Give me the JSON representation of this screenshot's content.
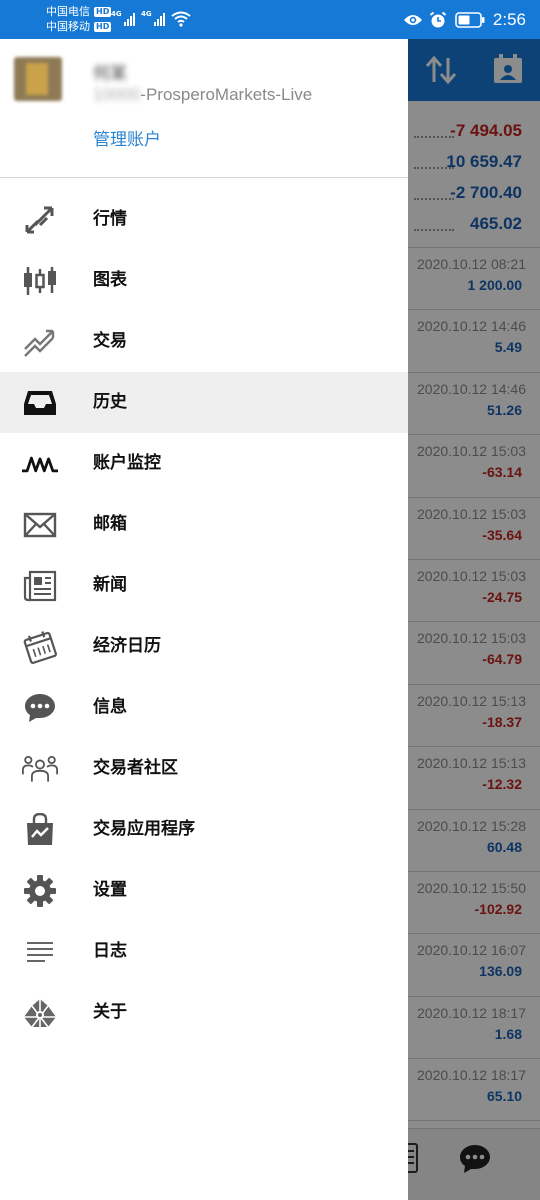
{
  "status_bar": {
    "carrier_1": "中国电信",
    "carrier_2": "中国移动",
    "hd": "HD",
    "network": "4G",
    "time": "2:56"
  },
  "account": {
    "name": "何某",
    "server_prefix": "10000",
    "server_suffix": "-ProsperoMarkets-Live",
    "manage_label": "管理账户"
  },
  "menu": [
    {
      "label": "行情",
      "icon": "quotes-arrows-icon"
    },
    {
      "label": "图表",
      "icon": "candlestick-chart-icon"
    },
    {
      "label": "交易",
      "icon": "trade-trend-icon"
    },
    {
      "label": "历史",
      "icon": "history-inbox-icon",
      "active": true
    },
    {
      "label": "账户监控",
      "icon": "account-monitor-icon"
    },
    {
      "label": "邮箱",
      "icon": "mail-envelope-icon"
    },
    {
      "label": "新闻",
      "icon": "news-icon"
    },
    {
      "label": "经济日历",
      "icon": "economic-calendar-icon"
    },
    {
      "label": "信息",
      "icon": "chat-bubble-icon"
    },
    {
      "label": "交易者社区",
      "icon": "community-people-icon"
    },
    {
      "label": "交易应用程序",
      "icon": "market-bag-icon"
    },
    {
      "label": "设置",
      "icon": "gear-icon"
    },
    {
      "label": "日志",
      "icon": "journal-lines-icon"
    },
    {
      "label": "关于",
      "icon": "about-logo-icon"
    }
  ],
  "background": {
    "summary": [
      {
        "value": "-7 494.05",
        "tone": "neg"
      },
      {
        "value": "10 659.47",
        "tone": "pos"
      },
      {
        "value": "-2 700.40",
        "tone": "pos"
      },
      {
        "value": "465.02",
        "tone": "pos"
      }
    ],
    "deals": [
      {
        "date": "2020.10.12 08:21",
        "amount": "1 200.00",
        "tone": "pos"
      },
      {
        "date": "2020.10.12 14:46",
        "amount": "5.49",
        "tone": "pos"
      },
      {
        "date": "2020.10.12 14:46",
        "amount": "51.26",
        "tone": "pos"
      },
      {
        "date": "2020.10.12 15:03",
        "amount": "-63.14",
        "tone": "neg"
      },
      {
        "date": "2020.10.12 15:03",
        "amount": "-35.64",
        "tone": "neg"
      },
      {
        "date": "2020.10.12 15:03",
        "amount": "-24.75",
        "tone": "neg"
      },
      {
        "date": "2020.10.12 15:03",
        "amount": "-64.79",
        "tone": "neg"
      },
      {
        "date": "2020.10.12 15:13",
        "amount": "-18.37",
        "tone": "neg"
      },
      {
        "date": "2020.10.12 15:13",
        "amount": "-12.32",
        "tone": "neg"
      },
      {
        "date": "2020.10.12 15:28",
        "amount": "60.48",
        "tone": "pos"
      },
      {
        "date": "2020.10.12 15:50",
        "amount": "-102.92",
        "tone": "neg"
      },
      {
        "date": "2020.10.12 16:07",
        "amount": "136.09",
        "tone": "pos"
      },
      {
        "date": "2020.10.12 18:17",
        "amount": "1.68",
        "tone": "pos"
      },
      {
        "date": "2020.10.12 18:17",
        "amount": "65.10",
        "tone": "pos"
      }
    ]
  },
  "colors": {
    "primary_blue": "#1679d6",
    "link_blue": "#2a84d2",
    "positive": "#1a5fb4",
    "negative": "#c3231f"
  }
}
